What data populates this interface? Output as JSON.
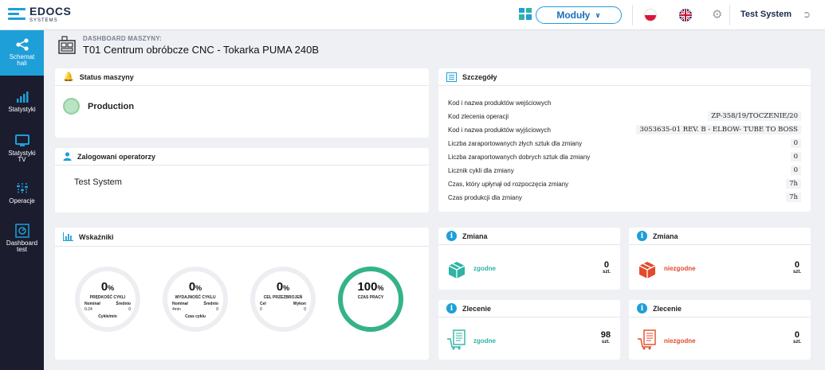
{
  "app": {
    "logo_main": "EDOCS",
    "logo_sub": "SYSTEMS",
    "modules_label": "Moduły",
    "user_name": "Test System"
  },
  "sidebar": {
    "items": [
      {
        "label": "Schemat hali",
        "icon": "share-icon",
        "active": true
      },
      {
        "label": "Statystyki",
        "icon": "bar-chart-icon",
        "active": false
      },
      {
        "label": "Statystyki TV",
        "icon": "monitor-icon",
        "active": false
      },
      {
        "label": "Operacje",
        "icon": "sliders-icon",
        "active": false
      },
      {
        "label": "Dashboard test",
        "icon": "dashboard-icon",
        "active": false
      }
    ]
  },
  "header": {
    "label": "DASHBOARD MASZYNY:",
    "title": "T01 Centrum obróbcze CNC - Tokarka PUMA 240B"
  },
  "status": {
    "title": "Status maszyny",
    "value": "Production"
  },
  "operators": {
    "title": "Zalogowani operatorzy",
    "name": "Test System"
  },
  "details": {
    "title": "Szczegóły",
    "rows": [
      {
        "label": "Kod i nazwa produktów wejściowych",
        "value": ""
      },
      {
        "label": "Kod zlecenia operacji",
        "value": "ZP-358/19/TOCZENIE/20"
      },
      {
        "label": "Kod i nazwa produktów wyjściowych",
        "value": "3053635-01 REV. B - ELBOW- TUBE TO BOSS"
      },
      {
        "label": "Liczba zaraportowanych złych sztuk dla zmiany",
        "value": "0"
      },
      {
        "label": "Liczba zaraportowanych dobrych sztuk dla zmiany",
        "value": "0"
      },
      {
        "label": "Licznik cykli dla zmiany",
        "value": "0"
      },
      {
        "label": "Czas, który upłynął od rozpoczęcia zmiany",
        "value": "7h"
      },
      {
        "label": "Czas produkcji dla zmiany",
        "value": "7h"
      }
    ]
  },
  "indicators": {
    "title": "Wskaźniki",
    "gauges": [
      {
        "value": "0",
        "pct": "%",
        "fill": 0,
        "name": "PRĘDKOŚĆ CYKLI",
        "sub_l": "Nominał",
        "sub_r": "Średnio",
        "val_l": "0.24",
        "val_r": "0",
        "unit": "Cykle/min"
      },
      {
        "value": "0",
        "pct": "%",
        "fill": 0,
        "name": "WYDAJNOŚĆ CYKLU",
        "sub_l": "Nominał",
        "sub_r": "Średnio",
        "val_l": "4min",
        "val_r": "0",
        "unit": "Czas cyklu"
      },
      {
        "value": "0",
        "pct": "%",
        "fill": 0,
        "name": "CEL PRZEZBROJEŃ",
        "sub_l": "Cel",
        "sub_r": "Wykon",
        "val_l": "0",
        "val_r": "0",
        "unit": ""
      },
      {
        "value": "100",
        "pct": "%",
        "fill": 1,
        "name": "CZAS PRACY",
        "sub_l": "",
        "sub_r": "",
        "val_l": "",
        "val_r": "",
        "unit": ""
      }
    ]
  },
  "counters": [
    {
      "title": "Zmiana",
      "label": "zgodne",
      "value": "0",
      "unit": "szt."
    },
    {
      "title": "Zmiana",
      "label": "niezgodne",
      "value": "0",
      "unit": "szt."
    },
    {
      "title": "Zlecenie",
      "label": "zgodne",
      "value": "98",
      "unit": "szt."
    },
    {
      "title": "Zlecenie",
      "label": "niezgodne",
      "value": "0",
      "unit": "szt."
    }
  ],
  "colors": {
    "accent": "#1e9fd8",
    "sidebar": "#1b1c2e",
    "ok": "#2fb3a5",
    "bad": "#e34a2a",
    "gauge_track": "#eceef1",
    "gauge_fill": "#34b38a"
  }
}
